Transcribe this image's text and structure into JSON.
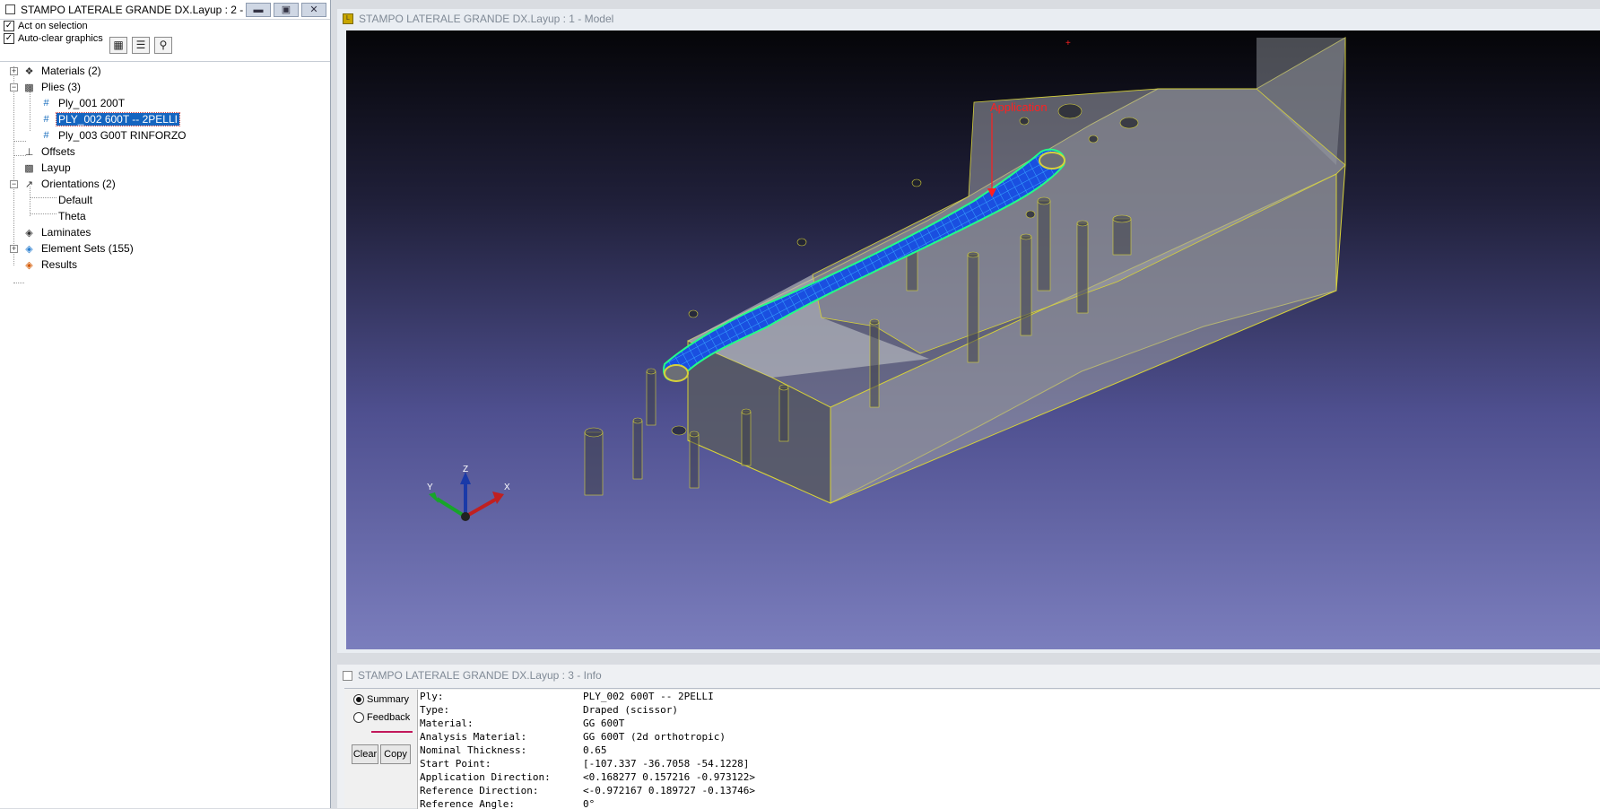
{
  "left_window": {
    "title": "STAMPO LATERALE GRANDE DX.Layup : 2 - ...",
    "options": [
      {
        "label": "Act on selection",
        "checked": true
      },
      {
        "label": "Auto-clear graphics",
        "checked": true
      }
    ],
    "tools": [
      "properties-icon",
      "list-icon",
      "find-icon"
    ],
    "tree": {
      "materials": "Materials (2)",
      "plies": "Plies (3)",
      "ply_1": "Ply_001 200T",
      "ply_2": "PLY_002 600T -- 2PELLI",
      "ply_3": "Ply_003 G00T RINFORZO",
      "offsets": "Offsets",
      "layup": "Layup",
      "orientations": "Orientations (2)",
      "orient_1": "Default",
      "orient_2": "Theta",
      "laminates": "Laminates",
      "element_sets": "Element Sets (155)",
      "results": "Results"
    }
  },
  "model_window": {
    "title": "STAMPO LATERALE GRANDE DX.Layup : 1 - Model",
    "annotation": "Application",
    "axes": {
      "x": "X",
      "y": "Y",
      "z": "Z"
    }
  },
  "info_window": {
    "title": "STAMPO LATERALE GRANDE DX.Layup : 3 - Info",
    "radios": [
      {
        "label": "Summary",
        "selected": true
      },
      {
        "label": "Feedback",
        "selected": false
      }
    ],
    "clear_label": "Clear",
    "copy_label": "Copy",
    "rows": [
      {
        "key": "Ply:",
        "value": "PLY_002 600T -- 2PELLI"
      },
      {
        "key": "Type:",
        "value": "Draped (scissor)"
      },
      {
        "key": "Material:",
        "value": "GG 600T"
      },
      {
        "key": "Analysis Material:",
        "value": "GG 600T (2d orthotropic)"
      },
      {
        "key": "Nominal Thickness:",
        "value": "0.65"
      },
      {
        "key": "Start Point:",
        "value": "[-107.337 -36.7058 -54.1228]"
      },
      {
        "key": "Application Direction:",
        "value": "<0.168277 0.157216 -0.973122>"
      },
      {
        "key": "Reference Direction:",
        "value": "<-0.972167 0.189727 -0.13746>"
      },
      {
        "key": "Reference Angle:",
        "value": "0°"
      }
    ]
  },
  "colors": {
    "selection": "#1565c0",
    "annotation": "#ff2020",
    "ply_mesh": "#1e5cff",
    "ply_edge": "#22ff88",
    "mould_edge": "#d6d13a"
  }
}
